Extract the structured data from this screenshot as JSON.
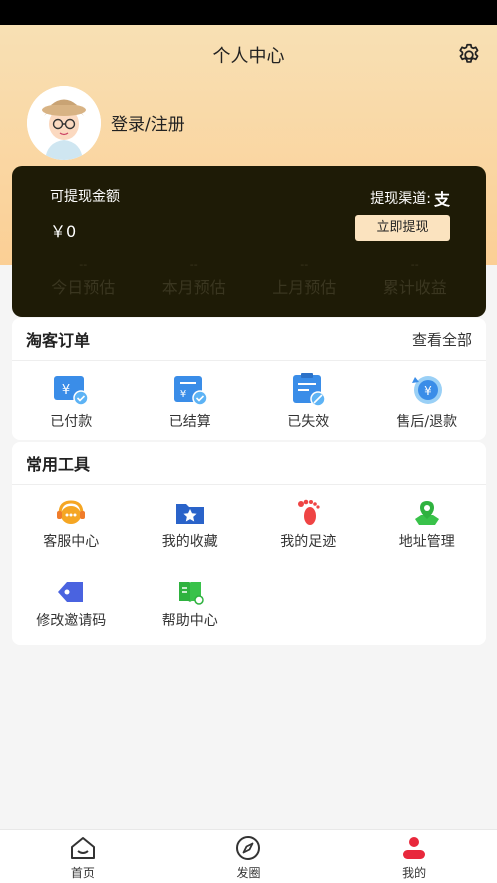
{
  "header": {
    "title": "个人中心",
    "login_text": "登录/注册"
  },
  "earnings": {
    "withdrawable_label": "可提现金额",
    "amount": "￥0",
    "channel_label": "提现渠道:",
    "channel_icon": "支",
    "withdraw_button": "立即提现",
    "stats": [
      {
        "value": "--",
        "label": "今日预估"
      },
      {
        "value": "--",
        "label": "本月预估"
      },
      {
        "value": "--",
        "label": "上月预估"
      },
      {
        "value": "--",
        "label": "累计收益"
      }
    ]
  },
  "orders": {
    "title": "淘客订单",
    "see_all": "查看全部",
    "items": [
      {
        "label": "已付款",
        "icon": "paid-icon"
      },
      {
        "label": "已结算",
        "icon": "settled-icon"
      },
      {
        "label": "已失效",
        "icon": "expired-icon"
      },
      {
        "label": "售后/退款",
        "icon": "refund-icon"
      }
    ]
  },
  "tools": {
    "title": "常用工具",
    "items": [
      {
        "label": "客服中心",
        "icon": "customer-service-icon"
      },
      {
        "label": "我的收藏",
        "icon": "favorites-icon"
      },
      {
        "label": "我的足迹",
        "icon": "footprint-icon"
      },
      {
        "label": "地址管理",
        "icon": "address-icon"
      },
      {
        "label": "修改邀请码",
        "icon": "tag-icon"
      },
      {
        "label": "帮助中心",
        "icon": "help-book-icon"
      }
    ]
  },
  "nav": [
    {
      "label": "首页",
      "icon": "home-icon"
    },
    {
      "label": "发圈",
      "icon": "compass-icon"
    },
    {
      "label": "我的",
      "icon": "profile-icon"
    }
  ],
  "colors": {
    "accent": "#e8283c",
    "card_bg": "#1e1b06",
    "header_bg": "#fbcf95",
    "icon_blue": "#3a8de8"
  }
}
